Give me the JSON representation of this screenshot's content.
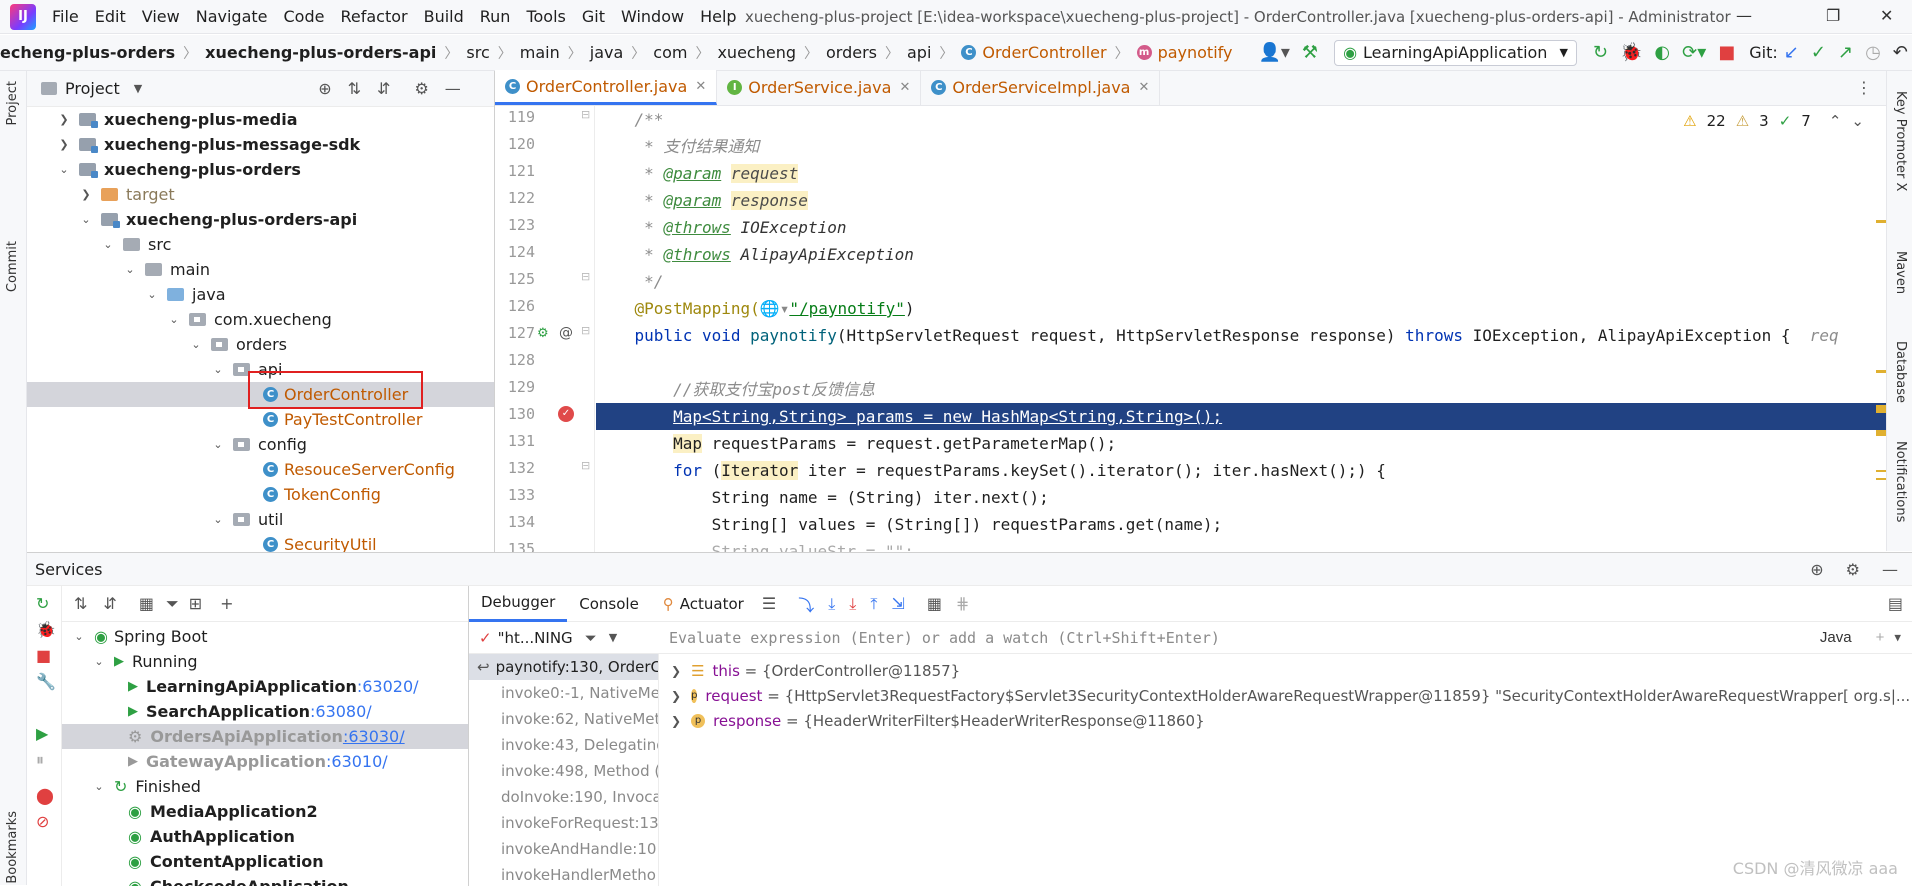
{
  "menu": [
    "File",
    "Edit",
    "View",
    "Navigate",
    "Code",
    "Refactor",
    "Build",
    "Run",
    "Tools",
    "Git",
    "Window",
    "Help"
  ],
  "window_title": "xuecheng-plus-project [E:\\idea-workspace\\xuecheng-plus-project] - OrderController.java [xuecheng-plus-orders-api] - Administrator",
  "breadcrumb": [
    "echeng-plus-orders",
    "xuecheng-plus-orders-api",
    "src",
    "main",
    "java",
    "com",
    "xuecheng",
    "orders",
    "api",
    "OrderController",
    "paynotify"
  ],
  "run_config": "LearningApiApplication",
  "git_label": "Git:",
  "project_panel": {
    "title": "Project"
  },
  "tree": [
    {
      "label": "xuecheng-plus-media",
      "bold": true
    },
    {
      "label": "xuecheng-plus-message-sdk",
      "bold": true
    },
    {
      "label": "xuecheng-plus-orders",
      "bold": true
    },
    {
      "label": "target"
    },
    {
      "label": "xuecheng-plus-orders-api",
      "bold": true
    },
    {
      "label": "src"
    },
    {
      "label": "main"
    },
    {
      "label": "java"
    },
    {
      "label": "com.xuecheng"
    },
    {
      "label": "orders"
    },
    {
      "label": "api"
    },
    {
      "label": "OrderController"
    },
    {
      "label": "PayTestController"
    },
    {
      "label": "config"
    },
    {
      "label": "ResouceServerConfig"
    },
    {
      "label": "TokenConfig"
    },
    {
      "label": "util"
    },
    {
      "label": "SecurityUtil"
    }
  ],
  "editor_tabs": [
    {
      "label": "OrderController.java",
      "active": true
    },
    {
      "label": "OrderService.java"
    },
    {
      "label": "OrderServiceImpl.java"
    }
  ],
  "inspections": {
    "warnings": "22",
    "weak": "3",
    "ok": "7"
  },
  "line_numbers": [
    "119",
    "120",
    "121",
    "122",
    "123",
    "124",
    "125",
    "126",
    "127",
    "128",
    "129",
    "130",
    "131",
    "132",
    "133",
    "134",
    "135"
  ],
  "code": {
    "l119": "/**",
    "l120": " * 支付结果通知",
    "l121_tag": "@param",
    "l121_name": "request",
    "l122_tag": "@param",
    "l122_name": "response",
    "l123_tag": "@throws",
    "l123_rest": " IOException",
    "l124_tag": "@throws",
    "l124_rest": " AlipayApiException",
    "l125": " */",
    "l126_ann": "@PostMapping(",
    "l126_str": "\"/paynotify\"",
    "l126_end": ")",
    "l127_kw": "public void ",
    "l127_fn": "paynotify",
    "l127_params": "(HttpServletRequest request, HttpServletResponse response) ",
    "l127_kw2": "throws",
    "l127_rest": " IOException, AlipayApiException {",
    "l127_hint": "req",
    "l129": "//获取支付宝post反馈信息",
    "l130": "Map<String,String> params = new HashMap<String,String>();",
    "l131_a": "Map",
    "l131_b": " requestParams = request.getParameterMap();",
    "l132_kw": "for",
    "l132_a": " (",
    "l132_b": "Iterator",
    "l132_c": " iter = requestParams.keySet().iterator(); iter.hasNext();) {",
    "l133": "String name = (String) iter.next();",
    "l134": "String[] values = (String[]) requestParams.get(name);",
    "l135": "String valueStr = \"\";"
  },
  "services": {
    "title": "Services",
    "tree": [
      {
        "label": "Spring Boot"
      },
      {
        "label": "Running"
      },
      {
        "label": "LearningApiApplication",
        "port": ":63020/"
      },
      {
        "label": "SearchApplication",
        "port": ":63080/"
      },
      {
        "label": "OrdersApiApplication",
        "port": ":63030/"
      },
      {
        "label": "GatewayApplication",
        "port": ":63010/"
      },
      {
        "label": "Finished"
      },
      {
        "label": "MediaApplication2"
      },
      {
        "label": "AuthApplication"
      },
      {
        "label": "ContentApplication"
      },
      {
        "label": "CheckcodeApplication"
      }
    ]
  },
  "debugger": {
    "tabs": [
      "Debugger",
      "Console",
      "Actuator"
    ],
    "thread": "\"ht...NING",
    "frames": [
      "paynotify:130, OrderC",
      "invoke0:-1, NativeMe",
      "invoke:62, NativeMet",
      "invoke:43, Delegating",
      "invoke:498, Method (",
      "doInvoke:190, Invoca",
      "invokeForRequest:13",
      "invokeAndHandle:10",
      "invokeHandlerMetho"
    ],
    "eval_placeholder": "Evaluate expression (Enter) or add a watch (Ctrl+Shift+Enter)",
    "lang": "Java",
    "vars": [
      {
        "name": "this",
        "value": "= {OrderController@11857}"
      },
      {
        "name": "request",
        "value": "= {HttpServlet3RequestFactory$Servlet3SecurityContextHolderAwareRequestWrapper@11859} \"SecurityContextHolderAwareRequestWrapper[ org.s|... View"
      },
      {
        "name": "response",
        "value": "= {HeaderWriterFilter$HeaderWriterResponse@11860}"
      }
    ]
  },
  "side_labels": {
    "project": "Project",
    "commit": "Commit",
    "bookmarks": "Bookmarks",
    "key_promoter": "Key Promoter X",
    "maven": "Maven",
    "database": "Database",
    "notifications": "Notifications"
  },
  "watermark": "CSDN @清风微凉 aaa"
}
